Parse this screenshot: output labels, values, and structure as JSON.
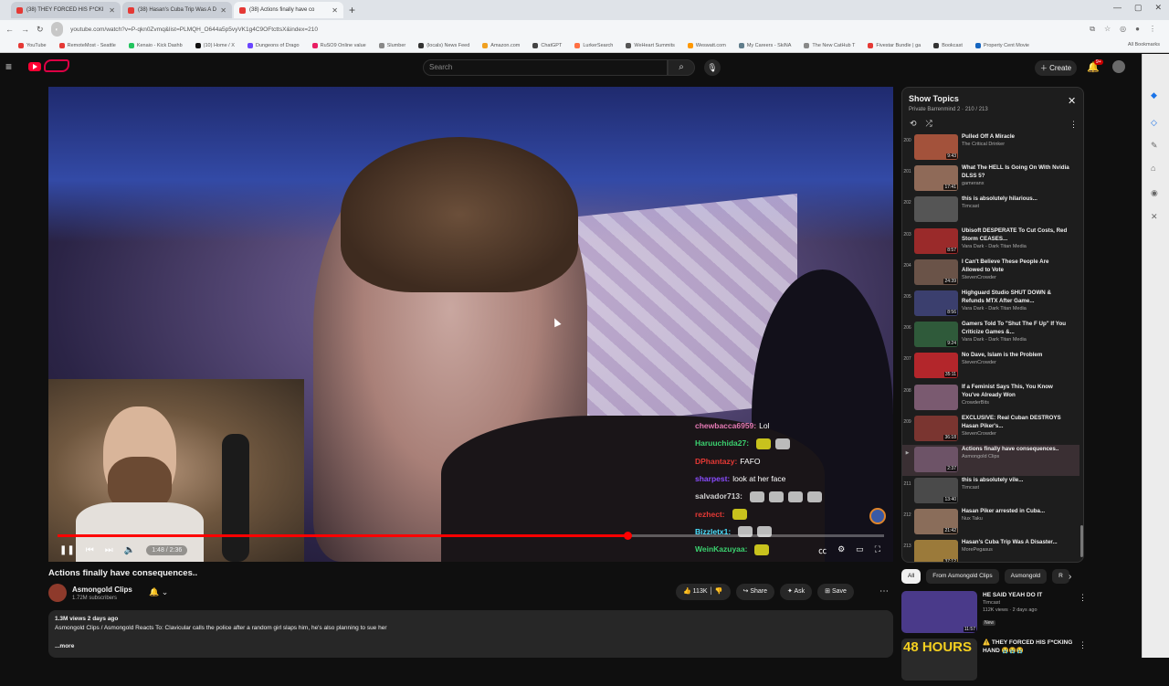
{
  "browser": {
    "tabs": [
      {
        "title": "(38) THEY FORCED HIS F*CKI",
        "active": false
      },
      {
        "title": "(38) Hasan's Cuba Trip Was A D",
        "active": false
      },
      {
        "title": "(38) Actions finally have co",
        "active": true
      }
    ],
    "url": "youtube.com/watch?v=P-qkn0Zvmq&list=PLMQH_O644a5p5vyVK1g4C9OFtcttsX&index=210",
    "bookmarks": [
      "YouTube",
      "RemoteMost - Seattle",
      "Kenaio - Kick Dashb",
      "(10) Home / X",
      "Dungeons of Drago",
      "RuSO9 Online value",
      "Slumber",
      "(locals) News Feed",
      "Amazon.com",
      "ChatGPT",
      "LurkerSearch",
      "WeHeart Summits",
      "Weswatt.com",
      "My Careers - SkiNA",
      "The New CatHub T",
      "Fivestar Bundle | ga",
      "Bookcast",
      "Property Cent Movie"
    ],
    "all_bookmarks": "All Bookmarks"
  },
  "yt": {
    "search_placeholder": "Search",
    "create_label": "Create",
    "notif_count": "9+"
  },
  "player": {
    "time": "1:48 / 2:36",
    "progress": 0.69,
    "chat": [
      {
        "user": "chewbacca6959:",
        "msg": "Lol",
        "color": "#e57ab5",
        "emotes": 0
      },
      {
        "user": "Haruuchida27:",
        "msg": "",
        "color": "#3bd16f",
        "emotes": 2
      },
      {
        "user": "DPhantazy:",
        "msg": "FAFO",
        "color": "#e53935",
        "emotes": 0
      },
      {
        "user": "sharpest:",
        "msg": "look at her face",
        "color": "#8a4cff",
        "emotes": 0
      },
      {
        "user": "salvador713:",
        "msg": "",
        "color": "#cfcfcf",
        "emotes": 4
      },
      {
        "user": "rezhect:",
        "msg": "",
        "color": "#e53935",
        "emotes": 1
      },
      {
        "user": "Bizzletx1:",
        "msg": "",
        "color": "#4be1ff",
        "emotes": 2
      },
      {
        "user": "WeinKazuyaa:",
        "msg": "",
        "color": "#3bd16f",
        "emotes": 1
      }
    ]
  },
  "video": {
    "title": "Actions finally have consequences..",
    "channel": "Asmongold Clips",
    "subscribers": "1.72M subscribers",
    "likes": "113K",
    "share": "Share",
    "ask": "Ask",
    "save": "Save",
    "views_date": "1.3M views  2 days ago",
    "description": "Asmongold Clips / Asmongold Reacts To: Clavicular calls the police after a random girl slaps him, he's also planning to sue her",
    "more": "...more"
  },
  "playlist": {
    "title": "Show Topics",
    "subtitle": "Private  Barrenmind 2 · 210 / 213",
    "items": [
      {
        "n": "200",
        "title": "Pulled Off A Miracle",
        "channel": "The Critical Drinker",
        "dur": "9:43",
        "color": "#a3523b"
      },
      {
        "n": "201",
        "title": "What The HELL Is Going On With Nvidia DLSS 5?",
        "channel": "gameranx",
        "dur": "17:41",
        "color": "#8f6a58"
      },
      {
        "n": "202",
        "title": "this is absolutely hilarious...",
        "channel": "Timcast",
        "dur": "",
        "color": "#555"
      },
      {
        "n": "203",
        "title": "Ubisoft DESPERATE To Cut Costs, Red Storm CEASES...",
        "channel": "Vara Dark - Dark Titan Media",
        "dur": "8:57",
        "color": "#9a2a2a"
      },
      {
        "n": "204",
        "title": "I Can't Believe These People Are Allowed to Vote",
        "channel": "StevenCrowder",
        "dur": "24:39",
        "color": "#6a5348"
      },
      {
        "n": "205",
        "title": "Highguard Studio SHUT DOWN & Refunds MTX After Game...",
        "channel": "Vara Dark - Dark Titan Media",
        "dur": "8:56",
        "color": "#3b3f6e"
      },
      {
        "n": "206",
        "title": "Gamers Told To \"Shut The F Up\" If You Criticize Games &...",
        "channel": "Vara Dark - Dark Titan Media",
        "dur": "9:24",
        "color": "#2f5a3a"
      },
      {
        "n": "207",
        "title": "No Dave, Islam is the Problem",
        "channel": "StevenCrowder",
        "dur": "35:11",
        "color": "#b3262b"
      },
      {
        "n": "208",
        "title": "If a Feminist Says This, You Know You've Already Won",
        "channel": "CrowderBits",
        "dur": "",
        "color": "#7a5a70"
      },
      {
        "n": "209",
        "title": "EXCLUSIVE: Real Cuban DESTROYS Hasan Piker's...",
        "channel": "StevenCrowder",
        "dur": "36:18",
        "color": "#7a3530"
      },
      {
        "n": "▶",
        "title": "Actions finally have consequences..",
        "channel": "Asmongold Clips",
        "dur": "2:37",
        "color": "#6d5367",
        "active": true
      },
      {
        "n": "211",
        "title": "this is absolutely vile...",
        "channel": "Timcast",
        "dur": "13:40",
        "color": "#4a4a4a"
      },
      {
        "n": "212",
        "title": "Hasan Piker arrested in Cuba...",
        "channel": "Nux Taku",
        "dur": "21:42",
        "color": "#8a6d5a"
      },
      {
        "n": "213",
        "title": "Hasan's Cuba Trip Was A Disaster...",
        "channel": "MorePegasus",
        "dur": "37:12",
        "color": "#9b7a3a"
      }
    ]
  },
  "chips": [
    "All",
    "From Asmongold Clips",
    "Asmongold",
    "R"
  ],
  "recommended": [
    {
      "title": "HE SAID YEAH DO IT",
      "channel": "Timcast",
      "meta": "112K views · 2 days ago",
      "badge": "New",
      "dur": "11:57",
      "color": "#4a3a8a"
    },
    {
      "title": "⚠️ THEY FORCED HIS F*CKING HAND 😭😭😭",
      "channel": "",
      "meta": "",
      "badge": "",
      "dur": "",
      "thumb_text": "48 HOURS",
      "color": "#2a2a2a"
    }
  ],
  "colors": {
    "accent": "#ff0000",
    "bg": "#0f0f0f"
  }
}
